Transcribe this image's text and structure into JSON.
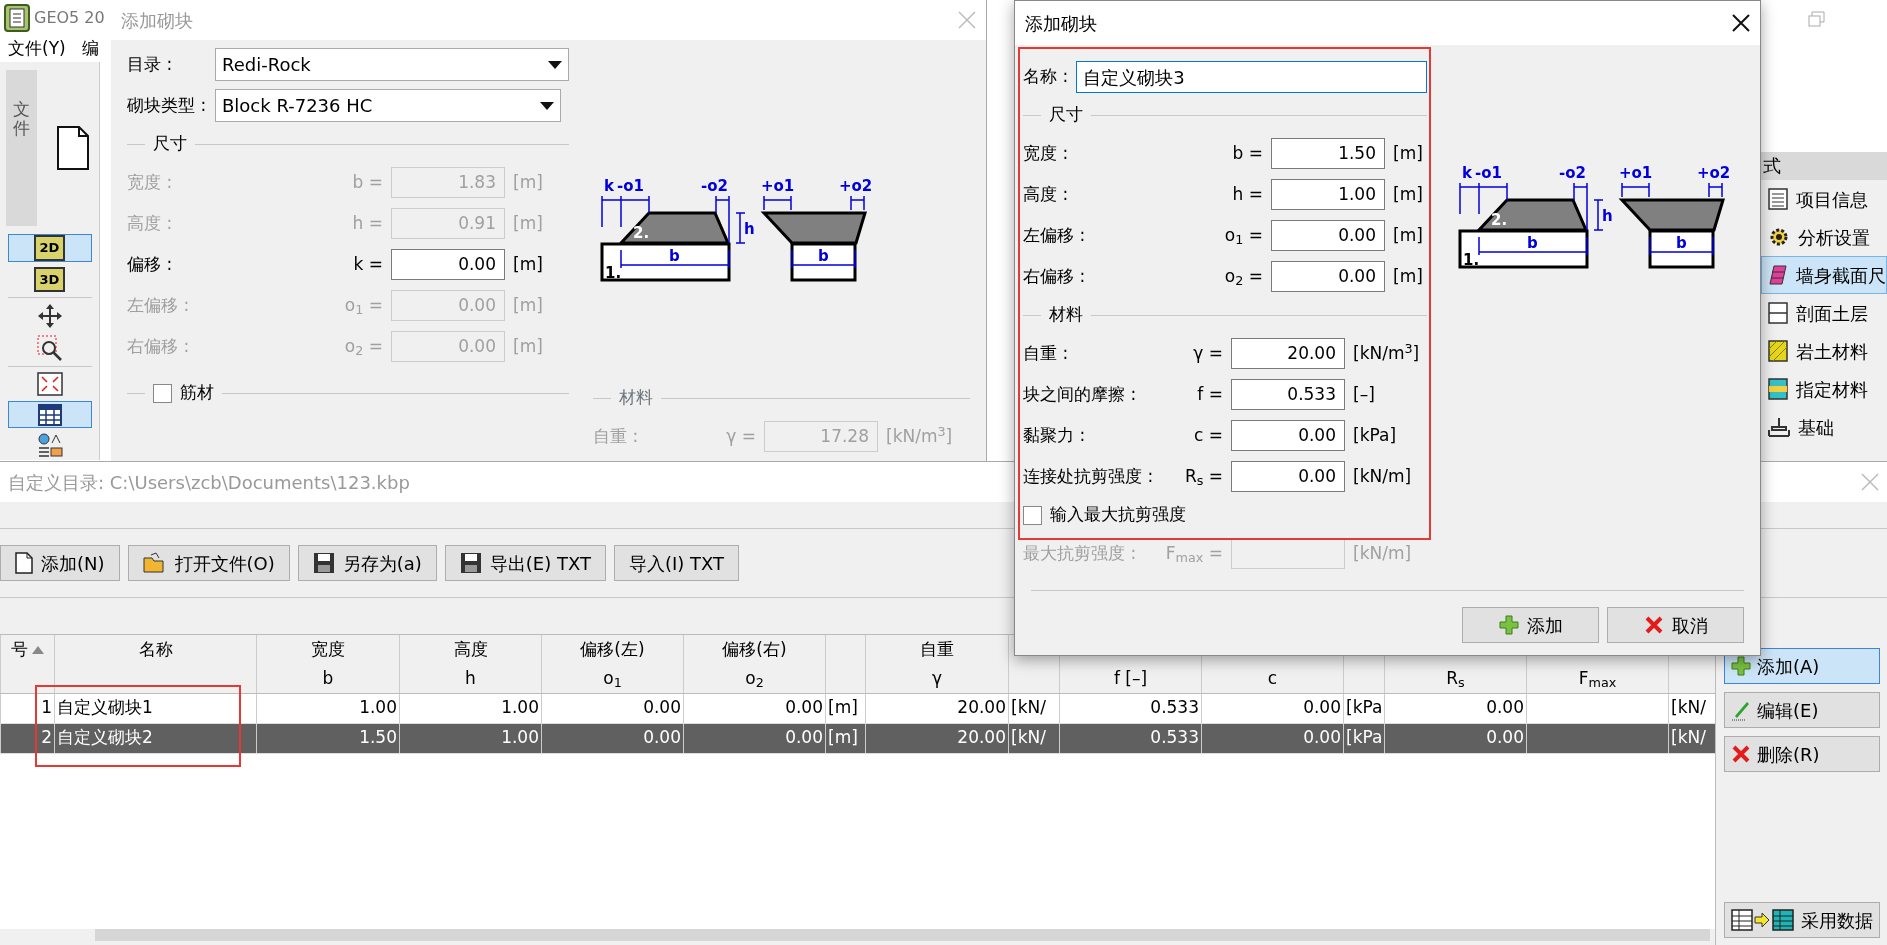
{
  "app": {
    "title": "GEO5 20",
    "menu": [
      "文件(Y)",
      "编"
    ],
    "toolbar_tab": "文件",
    "tools": [
      {
        "kind": "new",
        "selected": false
      },
      {
        "kind": "plan",
        "label": "2D",
        "selected": true
      },
      {
        "kind": "solid",
        "label": "3D",
        "selected": false
      },
      {
        "kind": "move",
        "selected": false
      },
      {
        "kind": "zoom",
        "selected": false
      },
      {
        "kind": "fit",
        "selected": false
      },
      {
        "kind": "table",
        "selected": true
      },
      {
        "kind": "legend",
        "selected": false
      }
    ],
    "side_panel": {
      "header": "式",
      "items": [
        {
          "kind": "info",
          "label": "项目信息",
          "selected": false
        },
        {
          "kind": "settings",
          "label": "分析设置",
          "selected": false
        },
        {
          "kind": "wall",
          "label": "墙身截面尺",
          "selected": true
        },
        {
          "kind": "layers",
          "label": "剖面土层",
          "selected": false
        },
        {
          "kind": "soil",
          "label": "岩土材料",
          "selected": false
        },
        {
          "kind": "assign",
          "label": "指定材料",
          "selected": false
        },
        {
          "kind": "foundation",
          "label": "基础",
          "selected": false
        }
      ]
    }
  },
  "back_dialog": {
    "title": "添加砌块",
    "catalog": {
      "label": "目录 :",
      "value": "Redi-Rock"
    },
    "block_type": {
      "label": "砌块类型 :",
      "value": "Block R-7236 HC"
    },
    "dimensions": {
      "title": "尺寸",
      "fields": [
        {
          "label": "宽度 :",
          "symbol": "b =",
          "value": "1.83",
          "unit": "[m]",
          "disabled": true
        },
        {
          "label": "高度 :",
          "symbol": "h =",
          "value": "0.91",
          "unit": "[m]",
          "disabled": true
        },
        {
          "label": "偏移 :",
          "symbol": "k =",
          "value": "0.00",
          "unit": "[m]",
          "disabled": false
        },
        {
          "label": "左偏移 :",
          "symbol": "o$_{1}$ =",
          "value": "0.00",
          "unit": "[m]",
          "disabled": true
        },
        {
          "label": "右偏移 :",
          "symbol": "o$_{2}$ =",
          "value": "0.00",
          "unit": "[m]",
          "disabled": true
        }
      ]
    },
    "reinforcement": {
      "label": "筋材",
      "checked": false
    },
    "diagram_labels": [
      "k",
      "-o1",
      "-o2",
      "h",
      "b",
      "1.",
      "2.",
      "+o1",
      "+o2",
      "b"
    ],
    "material": {
      "title": "材料",
      "fields": [
        {
          "label": "自重 :",
          "symbol": "γ =",
          "value": "17.28",
          "unit": "[kN/m$^{3}$]",
          "disabled": true
        }
      ]
    }
  },
  "front_dialog": {
    "title": "添加砌块",
    "name": {
      "label": "名称 :",
      "value": "自定义砌块3"
    },
    "dimensions": {
      "title": "尺寸",
      "fields": [
        {
          "label": "宽度 :",
          "symbol": "b =",
          "value": "1.50",
          "unit": "[m]",
          "disabled": false
        },
        {
          "label": "高度 :",
          "symbol": "h =",
          "value": "1.00",
          "unit": "[m]",
          "disabled": false
        },
        {
          "label": "左偏移 :",
          "symbol": "o$_{1}$ =",
          "value": "0.00",
          "unit": "[m]",
          "disabled": false
        },
        {
          "label": "右偏移 :",
          "symbol": "o$_{2}$ =",
          "value": "0.00",
          "unit": "[m]",
          "disabled": false
        }
      ]
    },
    "material": {
      "title": "材料",
      "fields": [
        {
          "label": "自重 :",
          "symbol": "γ =",
          "value": "20.00",
          "unit": "[kN/m$^{3}$]",
          "disabled": false
        },
        {
          "label": "块之间的摩擦 :",
          "symbol": "f =",
          "value": "0.533",
          "unit": "[–]",
          "disabled": false
        },
        {
          "label": "黏聚力 :",
          "symbol": "c =",
          "value": "0.00",
          "unit": "[kPa]",
          "disabled": false
        },
        {
          "label": "连接处抗剪强度 :",
          "symbol": "R$_{s}$ =",
          "value": "0.00",
          "unit": "[kN/m]",
          "disabled": false
        }
      ]
    },
    "max_shear_toggle": {
      "label": "输入最大抗剪强度",
      "checked": false
    },
    "max_shear": {
      "label": "最大抗剪强度 :",
      "symbol": "F$_{max}$ =",
      "unit": "[kN/m]",
      "disabled": true
    },
    "diagram_labels": [
      "k",
      "-o1",
      "-o2",
      "h",
      "b",
      "1.",
      "2.",
      "+o1",
      "+o2",
      "b"
    ],
    "buttons": [
      {
        "kind": "add",
        "label": "添加"
      },
      {
        "kind": "cancel",
        "label": "取消"
      }
    ]
  },
  "catalog_window": {
    "title": "自定义目录: C:\\Users\\zcb\\Documents\\123.kbp",
    "toolbar": [
      {
        "kind": "new",
        "label": "添加(N)"
      },
      {
        "kind": "open",
        "label": "打开文件(O)"
      },
      {
        "kind": "save",
        "label": "另存为(a)"
      },
      {
        "kind": "save",
        "label": "导出(E) TXT"
      },
      {
        "kind": "plain",
        "label": "导入(I) TXT"
      }
    ],
    "table": {
      "columns": [
        {
          "title": "号",
          "sorted": true
        },
        {
          "title": "名称",
          "sorted": false
        },
        {
          "title": "宽度",
          "symbol": "b",
          "sorted": false
        },
        {
          "title": "高度",
          "symbol": "h",
          "sorted": false
        },
        {
          "title": "偏移(左)",
          "symbol": "o$_{1}$",
          "sorted": false
        },
        {
          "title": "偏移(右)",
          "symbol": "o$_{2}$",
          "sorted": false
        },
        {
          "sorted": false
        },
        {
          "title": "自重",
          "symbol": "γ",
          "sorted": false
        },
        {
          "sorted": false
        },
        {
          "symbol": "f [–]",
          "sorted": false
        },
        {
          "symbol": "c",
          "sorted": false
        },
        {
          "sorted": false
        },
        {
          "symbol": "R$_{s}$",
          "sorted": false
        },
        {
          "symbol": "F$_{max}$",
          "sorted": false
        },
        {
          "sorted": false
        }
      ],
      "rows": [
        {
          "selected": false,
          "cells": [
            "1",
            "自定义砌块1",
            "1.00",
            "1.00",
            "0.00",
            "0.00",
            "[m]",
            "20.00",
            "[kN/",
            "0.533",
            "0.00",
            "[kPa",
            "0.00",
            null,
            "[kN/"
          ]
        },
        {
          "selected": true,
          "cells": [
            "2",
            "自定义砌块2",
            "1.50",
            "1.00",
            "0.00",
            "0.00",
            "[m]",
            "20.00",
            "[kN/",
            "0.533",
            "0.00",
            "[kPa",
            "0.00",
            null,
            "[kN/"
          ]
        }
      ]
    },
    "side_buttons": [
      {
        "kind": "add",
        "label": "添加(A)",
        "selected": true
      },
      {
        "kind": "edit",
        "label": "编辑(E)",
        "selected": false
      },
      {
        "kind": "delete",
        "label": "删除(R)",
        "selected": false
      }
    ],
    "apply_button": {
      "label": "采用数据"
    }
  }
}
